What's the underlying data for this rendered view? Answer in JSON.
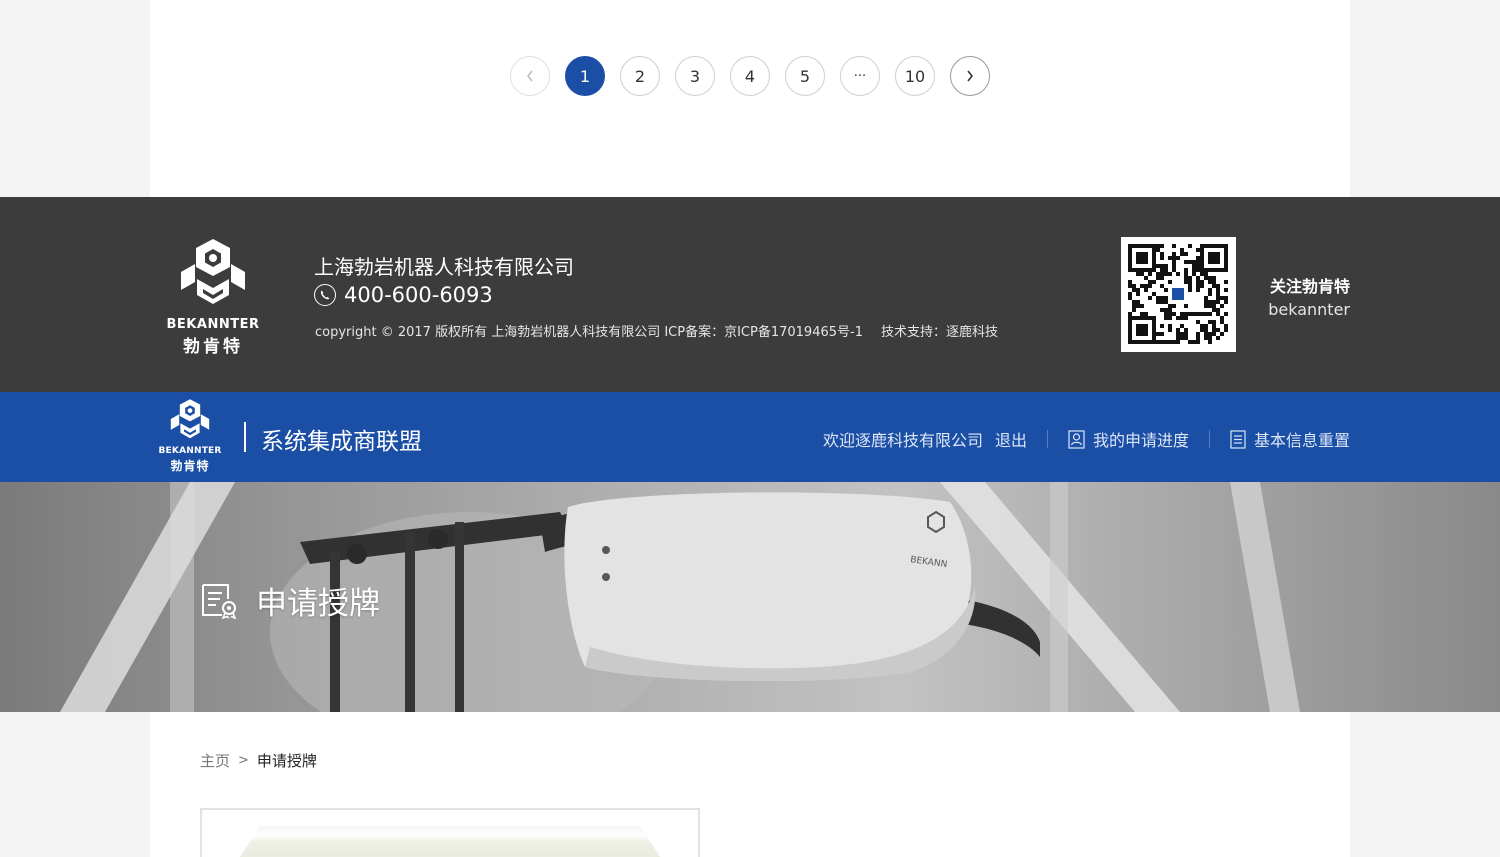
{
  "pagination": {
    "pages": [
      "1",
      "2",
      "3",
      "4",
      "5",
      "···",
      "10"
    ],
    "active": "1"
  },
  "footer": {
    "logo_word": "BEKANNTER",
    "logo_cn": "勃肯特",
    "company_name": "上海勃岩机器人科技有限公司",
    "phone": "400-600-6093",
    "copyright": "copyright © 2017 版权所有 上海勃岩机器人科技有限公司  ICP备案：京ICP备17019465号-1",
    "tech_support": "技术支持：逐鹿科技",
    "follow_title": "关注勃肯特",
    "follow_sub": "bekannter"
  },
  "header": {
    "logo_word": "BEKANNTER",
    "logo_cn": "勃肯特",
    "title": "系统集成商联盟",
    "welcome": "欢迎逐鹿科技有限公司",
    "logout": "退出",
    "nav": [
      {
        "label": "我的申请进度",
        "icon": "person-doc-icon"
      },
      {
        "label": "基本信息重置",
        "icon": "document-icon"
      }
    ]
  },
  "banner": {
    "title": "申请授牌"
  },
  "breadcrumb": {
    "home": "主页",
    "separator": ">",
    "current": "申请授牌"
  },
  "colors": {
    "brand_blue": "#1b4fa6",
    "footer_bg": "#3c3c3c",
    "page_bg": "#f3f3f3"
  }
}
